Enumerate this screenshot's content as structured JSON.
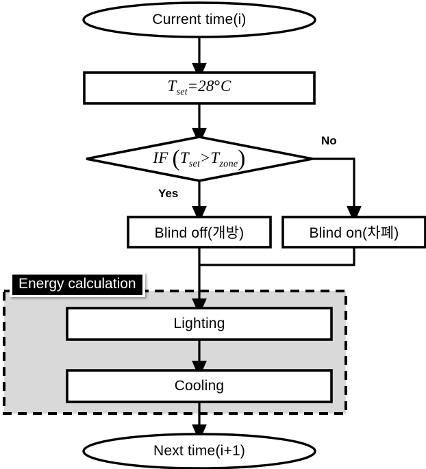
{
  "diagram": {
    "title": "Blind control and energy calculation flowchart",
    "colors": {
      "stroke": "#000000",
      "fill_white": "#ffffff",
      "group_fill": "#d9d9d9",
      "banner_bg": "#000000",
      "banner_text": "#ffffff"
    },
    "nodes": {
      "start": {
        "label": "Current time(i)",
        "shape": "ellipse"
      },
      "setpoint": {
        "shape": "rectangle",
        "formula_text": "T_set = 28°C",
        "variable": "T",
        "subscript": "set",
        "operator": "=",
        "value": "28",
        "degree": "°",
        "unit": "C"
      },
      "decision": {
        "shape": "diamond",
        "formula_text": "IF (T_set > T_zone)",
        "keyword": "IF",
        "left_var": "T",
        "left_sub": "set",
        "operator": ">",
        "right_var": "T",
        "right_sub": "zone",
        "paren_open": "(",
        "paren_close": ")"
      },
      "blind_off": {
        "label": "Blind off(개방)",
        "shape": "rectangle"
      },
      "blind_on": {
        "label": "Blind on(차폐)",
        "shape": "rectangle"
      },
      "lighting": {
        "label": "Lighting",
        "shape": "rectangle"
      },
      "cooling": {
        "label": "Cooling",
        "shape": "rectangle"
      },
      "end": {
        "label": "Next time(i+1)",
        "shape": "ellipse"
      }
    },
    "group": {
      "banner_label": "Energy calculation",
      "border_style": "dashed",
      "fill": "#d9d9d9"
    },
    "edge_labels": {
      "yes": "Yes",
      "no": "No"
    }
  }
}
